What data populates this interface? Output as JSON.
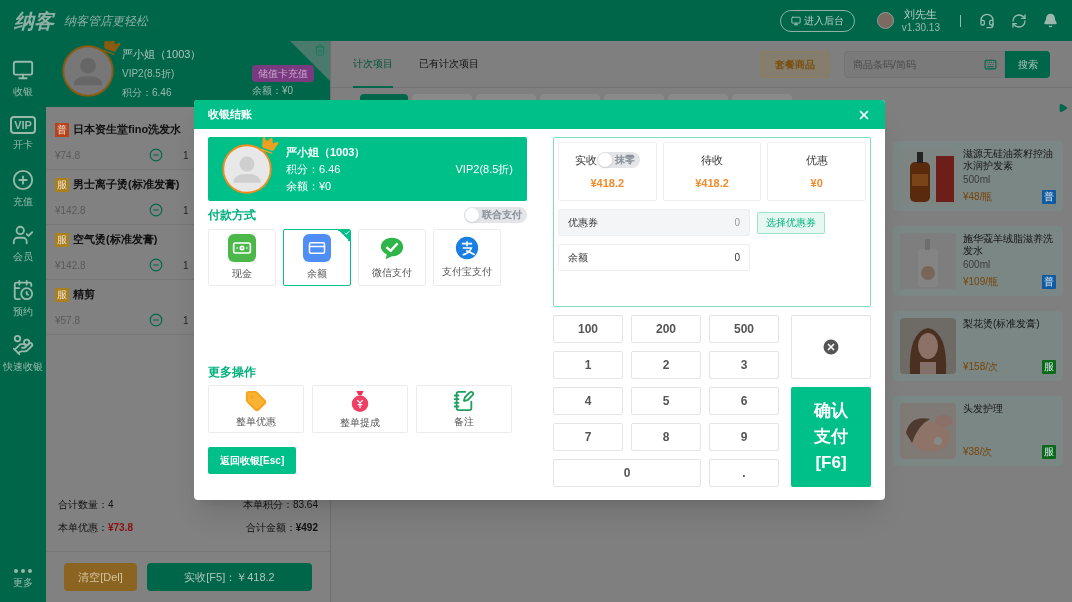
{
  "header": {
    "logo": "纳客",
    "slogan": "纳客管店更轻松",
    "admin_button": "进入后台",
    "user_name": "刘先生",
    "version": "v1.30.13"
  },
  "sidebar": {
    "items": [
      {
        "kind": "cashier",
        "label": "收银"
      },
      {
        "kind": "card",
        "label": "开卡",
        "badge": "VIP"
      },
      {
        "kind": "recharge",
        "label": "充值"
      },
      {
        "kind": "member",
        "label": "会员"
      },
      {
        "kind": "booking",
        "label": "预约"
      },
      {
        "kind": "quick",
        "label": "快速收银"
      }
    ],
    "more": "更多"
  },
  "member": {
    "name": "严小姐（1003）",
    "level": "VIP2(8.5折)",
    "points": "积分：6.46",
    "recharge_button": "储值卡充值",
    "balance": "余额：¥0"
  },
  "cart": {
    "items": [
      {
        "tag": "普",
        "color": "#b5431c",
        "name": "日本资生堂fino洗发水",
        "price": "¥74.8",
        "quantity": "1"
      },
      {
        "tag": "服",
        "color": "#a8801e",
        "name": "男士离子烫(标准发膏)",
        "price": "¥142.8",
        "quantity": "1"
      },
      {
        "tag": "服",
        "color": "#a8801e",
        "name": "空气烫(标准发膏)",
        "price": "¥142.8",
        "quantity": "1"
      },
      {
        "tag": "服",
        "color": "#a8801e",
        "name": "精剪",
        "price": "¥57.8",
        "quantity": "1"
      }
    ],
    "total_quantity": "合计数量：4",
    "points": "本单积分：83.64",
    "discount_label": "本单优惠：",
    "discount": "¥73.8",
    "total": "合计金额：**¥492**",
    "clear_button": "清空[Del]",
    "pay_button": "实收[F5]：￥418.2"
  },
  "content": {
    "tabs": [
      {
        "label": "计次项目",
        "selected": true
      },
      {
        "label": "已有计次项目",
        "selected": false
      }
    ],
    "package_button": "套餐商品",
    "search": {
      "placeholder": "商品条码/简码"
    },
    "search_button": "搜索",
    "categories": [
      {
        "selected": true
      },
      {
        "selected": false
      },
      {
        "selected": false
      },
      {
        "selected": false
      },
      {
        "selected": false
      },
      {
        "selected": false
      },
      {
        "selected": false
      }
    ],
    "products": [
      {
        "name": "滋源无硅油茶籽控油水润护发素",
        "spec": "500ml",
        "price": "¥48/瓶",
        "tag": "普",
        "color": "#0f5aa0"
      },
      {
        "name": "施华蔻羊绒脂滋养洗发水",
        "spec": "600ml",
        "price": "¥109/瓶",
        "tag": "普",
        "color": "#0f5aa0"
      },
      {
        "name": "梨花烫(标准发膏)",
        "price": "¥158/次",
        "tag": "服",
        "color": "#0b6a1a"
      },
      {
        "name": "头发护理",
        "price": "¥38/次",
        "tag": "服",
        "color": "#0b6a1a"
      }
    ]
  },
  "modal": {
    "title": "收银结账",
    "member": {
      "name": "严小姐（1003）",
      "points": "积分：6.46",
      "balance": "余额：¥0",
      "level": "VIP2(8.5折)"
    },
    "payment_title": "付款方式",
    "combined_toggle": {
      "label": "联合支付",
      "on": false
    },
    "methods": [
      {
        "kind": "cash",
        "label": "现金",
        "selected": false
      },
      {
        "kind": "balance",
        "label": "余额",
        "selected": true
      },
      {
        "kind": "wechat",
        "label": "微信支付",
        "selected": false
      },
      {
        "kind": "alipay",
        "label": "支付宝支付",
        "selected": false
      }
    ],
    "more_title": "更多操作",
    "operations": [
      {
        "kind": "discount",
        "label": "整单优惠"
      },
      {
        "kind": "commission",
        "label": "整单提成"
      },
      {
        "kind": "note",
        "label": "备注"
      }
    ],
    "back_button": "返回收银[Esc]",
    "totals": [
      {
        "label": "实收",
        "value": "¥418.2",
        "toggle": {
          "label": "抹零",
          "on": false
        }
      },
      {
        "label": "待收",
        "value": "¥418.2"
      },
      {
        "label": "优惠",
        "value": "¥0"
      }
    ],
    "coupon": {
      "label": "优惠券",
      "value": "0",
      "button": "选择优惠券"
    },
    "balance_field": {
      "label": "余额",
      "value": "0"
    },
    "keys": [
      {
        "kind": "digit",
        "label": "100"
      },
      {
        "kind": "digit",
        "label": "200"
      },
      {
        "kind": "digit",
        "label": "500"
      },
      {
        "kind": "digit",
        "label": "1"
      },
      {
        "kind": "digit",
        "label": "2"
      },
      {
        "kind": "digit",
        "label": "3"
      },
      {
        "kind": "digit",
        "label": "4"
      },
      {
        "kind": "digit",
        "label": "5"
      },
      {
        "kind": "digit",
        "label": "6"
      },
      {
        "kind": "digit",
        "label": "7"
      },
      {
        "kind": "digit",
        "label": "8"
      },
      {
        "kind": "digit",
        "label": "9"
      },
      {
        "kind": "wide",
        "label": "0"
      },
      {
        "kind": "digit",
        "label": "."
      }
    ],
    "confirm_button": "确认支付[F6]"
  }
}
